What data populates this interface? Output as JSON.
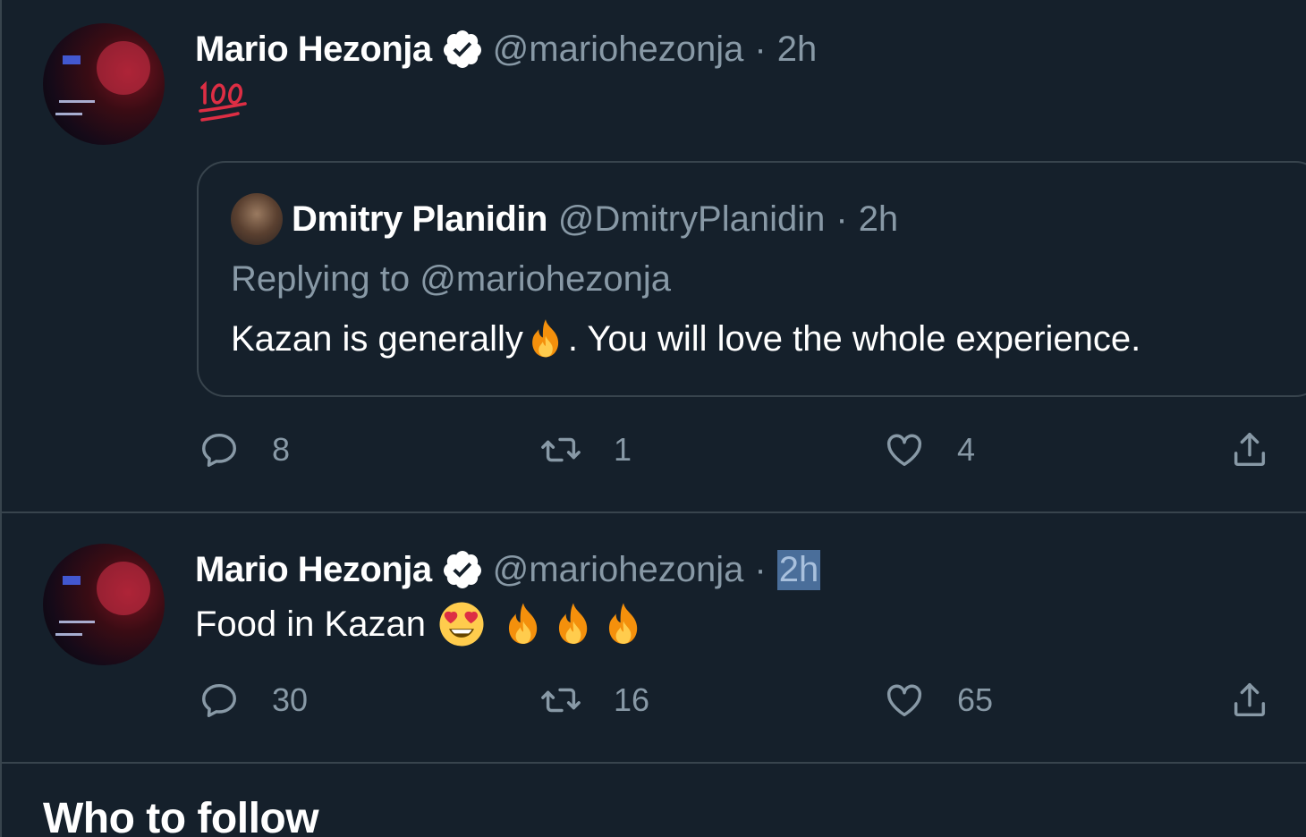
{
  "colors": {
    "background": "#15202b",
    "border": "#38444d",
    "secondary_text": "#8899a6",
    "verified_badge": "#ffffff",
    "selection": "#4a6e9a"
  },
  "tweets": [
    {
      "author_name": "Mario Hezonja",
      "verified": true,
      "handle": "@mariohezonja",
      "separator": "·",
      "time": "2h",
      "body_emoji": "hundred-points",
      "quote": {
        "author_name": "Dmitry Planidin",
        "handle": "@DmitryPlanidin",
        "separator": "·",
        "time": "2h",
        "replying_to": "Replying to @mariohezonja",
        "text_before": "Kazan is generally",
        "emoji": "fire",
        "text_after": ". You will love the whole experience."
      },
      "actions": {
        "replies": "8",
        "retweets": "1",
        "likes": "4"
      }
    },
    {
      "author_name": "Mario Hezonja",
      "verified": true,
      "handle": "@mariohezonja",
      "separator": "·",
      "time": "2h",
      "time_selected": true,
      "text": "Food in Kazan",
      "emojis": [
        "heart-eyes",
        "fire",
        "fire",
        "fire"
      ],
      "actions": {
        "replies": "30",
        "retweets": "16",
        "likes": "65"
      }
    }
  ],
  "sections": {
    "who_to_follow": "Who to follow"
  },
  "icons": {
    "reply": "reply-icon",
    "retweet": "retweet-icon",
    "like": "heart-icon",
    "share": "share-icon",
    "verified": "verified-badge-icon"
  }
}
